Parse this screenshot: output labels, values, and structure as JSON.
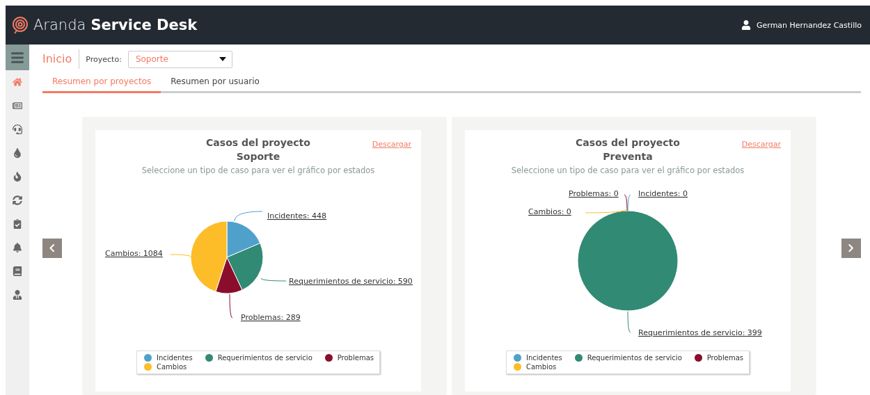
{
  "header": {
    "brand_light": "Aranda",
    "brand_bold": "Service Desk",
    "user": "German Hernandez Castillo"
  },
  "sidebar": {
    "items": [
      {
        "selected": true
      },
      {
        "selected": false
      },
      {
        "selected": false
      },
      {
        "selected": false
      },
      {
        "selected": false
      },
      {
        "selected": false
      },
      {
        "selected": false
      },
      {
        "selected": false
      },
      {
        "selected": false
      },
      {
        "selected": false
      }
    ]
  },
  "toolbar": {
    "title": "Inicio",
    "project_label": "Proyecto:",
    "project_value": "Soporte"
  },
  "tabs": [
    {
      "label": "Resumen por proyectos",
      "selected": true
    },
    {
      "label": "Resumen por usuario",
      "selected": false
    }
  ],
  "cards": [
    {
      "title": "Casos del proyecto",
      "project": "Soporte",
      "download": "Descargar",
      "subtitle": "Seleccione un tipo de caso para ver el gráfico por estados",
      "chart_data": {
        "type": "pie",
        "values": [
          448,
          590,
          289,
          1084
        ],
        "value_labels": [
          "Incidentes: 448",
          "Requerimientos de servicio: 590",
          "Problemas: 289",
          "Cambios: 1084"
        ]
      },
      "legend": [
        {
          "label": "Incidentes",
          "color": "#4fa1cc"
        },
        {
          "label": "Requerimientos de servicio",
          "color": "#318a74"
        },
        {
          "label": "Problemas",
          "color": "#8a0d2c"
        },
        {
          "label": "Cambios",
          "color": "#fdbd28"
        }
      ]
    },
    {
      "title": "Casos del proyecto",
      "project": "Preventa",
      "download": "Descargar",
      "subtitle": "Seleccione un tipo de caso para ver el gráfico por estados",
      "chart_data": {
        "type": "pie",
        "values": [
          0,
          399,
          0,
          0
        ],
        "value_labels": [
          "Incidentes: 0",
          "Requerimientos de servicio: 399",
          "Problemas: 0",
          "Cambios: 0"
        ]
      },
      "legend": [
        {
          "label": "Incidentes",
          "color": "#4fa1cc"
        },
        {
          "label": "Requerimientos de servicio",
          "color": "#318a74"
        },
        {
          "label": "Problemas",
          "color": "#8a0d2c"
        },
        {
          "label": "Cambios",
          "color": "#fdbd28"
        }
      ]
    }
  ]
}
